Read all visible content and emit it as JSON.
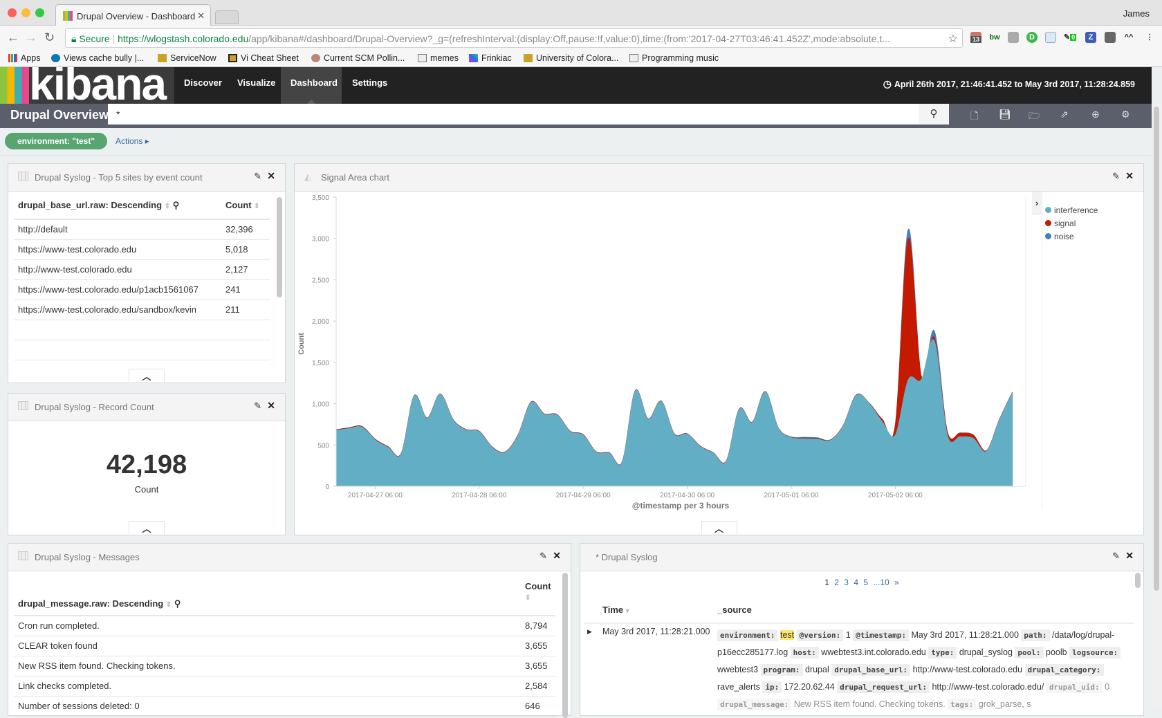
{
  "browser": {
    "tab_title": "Drupal Overview - Dashboard",
    "user": "James",
    "url_secure": "Secure",
    "url_host": "https://wlogstash.colorado.edu",
    "url_rest": "/app/kibana#/dashboard/Drupal-Overview?_g=(refreshInterval:(display:Off,pause:!f,value:0),time:(from:'2017-04-27T03:46:41.452Z',mode:absolute,t...",
    "ext_badges": [
      "13",
      "0"
    ],
    "bookmarks": [
      "Apps",
      "Views cache bully |...",
      "ServiceNow",
      "Vi Cheat Sheet",
      "Current SCM Pollin...",
      "memes",
      "Frinkiac",
      "University of Colora...",
      "Programming music"
    ]
  },
  "kibana": {
    "logo": "kibana",
    "nav": [
      "Discover",
      "Visualize",
      "Dashboard",
      "Settings"
    ],
    "active_nav": "Dashboard",
    "time_range": "April 26th 2017, 21:46:41.452 to May 3rd 2017, 11:28:24.859",
    "dashboard_title": "Drupal Overview",
    "query": "*",
    "filter": "environment: \"test\"",
    "actions": "Actions"
  },
  "panels": {
    "top5": {
      "title": "Drupal Syslog - Top 5 sites by event count",
      "col1": "drupal_base_url.raw: Descending",
      "col2": "Count",
      "rows": [
        [
          "http://default",
          "32,396"
        ],
        [
          "https://www-test.colorado.edu",
          "5,018"
        ],
        [
          "http://www-test.colorado.edu",
          "2,127"
        ],
        [
          "https://www-test.colorado.edu/p1acb1561067",
          "241"
        ],
        [
          "https://www-test.colorado.edu/sandbox/kevin",
          "211"
        ]
      ]
    },
    "record": {
      "title": "Drupal Syslog - Record Count",
      "value": "42,198",
      "label": "Count"
    },
    "messages": {
      "title": "Drupal Syslog - Messages",
      "col1": "drupal_message.raw: Descending",
      "col2": "Count",
      "rows": [
        [
          "Cron run completed.",
          "8,794"
        ],
        [
          "CLEAR token found",
          "3,655"
        ],
        [
          "New RSS item found. Checking tokens.",
          "3,655"
        ],
        [
          "Link checks completed.",
          "2,584"
        ],
        [
          "Number of sessions deleted: 0",
          "646"
        ]
      ]
    },
    "syslog": {
      "title": "* Drupal Syslog",
      "pages": [
        "1",
        "2",
        "3",
        "4",
        "5",
        "...10",
        "»"
      ],
      "col_time": "Time",
      "col_source": "_source",
      "row_time": "May 3rd 2017, 11:28:21.000",
      "fields": [
        [
          "environment:",
          "test"
        ],
        [
          "@version:",
          "1"
        ],
        [
          "@timestamp:",
          "May 3rd 2017, 11:28:21.000"
        ],
        [
          "path:",
          "/data/log/drupal-p16ecc285177.log"
        ],
        [
          "host:",
          "wwebtest3.int.colorado.edu"
        ],
        [
          "type:",
          "drupal_syslog"
        ],
        [
          "pool:",
          "poolb"
        ],
        [
          "logsource:",
          "wwebtest3"
        ],
        [
          "program:",
          "drupal"
        ],
        [
          "drupal_base_url:",
          "http://www-test.colorado.edu"
        ],
        [
          "drupal_category:",
          "rave_alerts"
        ],
        [
          "ip:",
          "172.20.62.44"
        ],
        [
          "drupal_request_url:",
          "http://www-test.colorado.edu/"
        ],
        [
          "drupal_uid:",
          "0"
        ],
        [
          "drupal_message:",
          "New RSS item found. Checking tokens."
        ],
        [
          "tags:",
          "grok_parse, s"
        ]
      ]
    },
    "chart": {
      "title": "Signal Area chart"
    }
  },
  "chart_data": {
    "type": "area",
    "stacked": true,
    "title": "Signal Area chart",
    "xlabel": "@timestamp per 3 hours",
    "ylabel": "Count",
    "ylim": [
      0,
      3500
    ],
    "yticks": [
      "0",
      "500",
      "1,000",
      "1,500",
      "2,000",
      "2,500",
      "3,000",
      "3,500"
    ],
    "xticks": [
      "2017-04-27 06:00",
      "2017-04-28 06:00",
      "2017-04-29 06:00",
      "2017-04-30 06:00",
      "2017-05-01 06:00",
      "2017-05-02 06:00"
    ],
    "x_start": "2017-04-26 21:00",
    "x_interval_hours": 3,
    "legend_position": "right",
    "series": [
      {
        "name": "interference",
        "color": "#62aec5",
        "values": [
          675,
          700,
          715,
          560,
          470,
          390,
          1090,
          820,
          1110,
          800,
          680,
          660,
          470,
          410,
          620,
          1015,
          870,
          860,
          660,
          620,
          410,
          400,
          290,
          1150,
          810,
          1025,
          630,
          630,
          480,
          400,
          300,
          930,
          770,
          1140,
          700,
          590,
          575,
          570,
          555,
          730,
          1100,
          1000,
          780,
          620,
          1290,
          1290,
          1760,
          620,
          600,
          580,
          420,
          800,
          1130
        ]
      },
      {
        "name": "signal",
        "color": "#c41a00",
        "values": [
          8,
          8,
          8,
          8,
          8,
          5,
          5,
          5,
          5,
          5,
          5,
          5,
          5,
          5,
          5,
          5,
          5,
          5,
          5,
          5,
          5,
          5,
          5,
          5,
          5,
          5,
          5,
          5,
          5,
          5,
          5,
          5,
          5,
          5,
          5,
          5,
          8,
          8,
          5,
          5,
          5,
          5,
          30,
          120,
          1710,
          40,
          40,
          40,
          45,
          40,
          8,
          5,
          5
        ]
      },
      {
        "name": "noise",
        "color": "#447ebc",
        "values": [
          2,
          2,
          2,
          2,
          2,
          2,
          2,
          2,
          2,
          2,
          2,
          2,
          2,
          2,
          2,
          2,
          2,
          2,
          2,
          2,
          2,
          2,
          2,
          2,
          2,
          2,
          2,
          2,
          2,
          2,
          2,
          2,
          2,
          2,
          2,
          2,
          10,
          10,
          2,
          2,
          2,
          2,
          2,
          5,
          110,
          5,
          80,
          2,
          2,
          2,
          2,
          2,
          2
        ]
      }
    ]
  }
}
